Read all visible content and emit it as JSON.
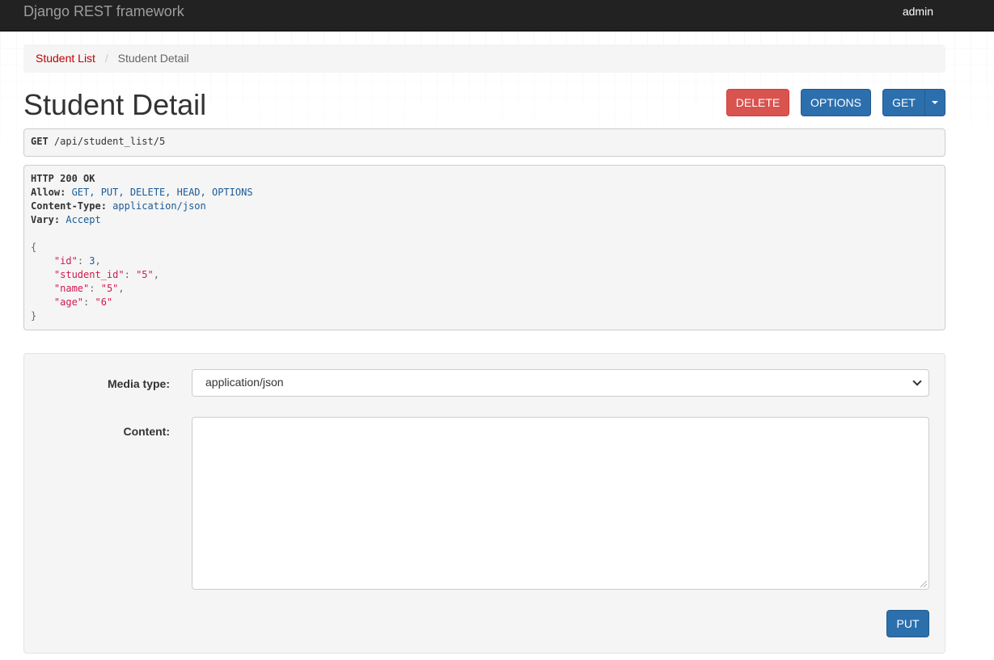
{
  "navbar": {
    "brand": "Django REST framework",
    "user": "admin"
  },
  "breadcrumb": [
    {
      "label": "Student List"
    },
    {
      "label": "Student Detail"
    }
  ],
  "page": {
    "title": "Student Detail"
  },
  "buttons": {
    "delete": "DELETE",
    "options": "OPTIONS",
    "get": "GET",
    "put": "PUT"
  },
  "request": {
    "method": "GET",
    "path": "/api/student_list/5"
  },
  "response": {
    "status": "HTTP 200 OK",
    "headers": [
      {
        "name": "Allow",
        "value": "GET, PUT, DELETE, HEAD, OPTIONS"
      },
      {
        "name": "Content-Type",
        "value": "application/json"
      },
      {
        "name": "Vary",
        "value": "Accept"
      }
    ],
    "body": [
      {
        "key": "\"id\"",
        "value": "3",
        "kind": "num"
      },
      {
        "key": "\"student_id\"",
        "value": "\"5\"",
        "kind": "str"
      },
      {
        "key": "\"name\"",
        "value": "\"5\"",
        "kind": "str"
      },
      {
        "key": "\"age\"",
        "value": "\"6\"",
        "kind": "str"
      }
    ]
  },
  "form": {
    "media_type_label": "Media type:",
    "media_type_value": "application/json",
    "content_label": "Content:",
    "content_value": ""
  },
  "colors": {
    "navbar": "#222222",
    "link": "#c20000",
    "primary": "#2c6fad",
    "danger": "#d9534f"
  },
  "icons": {
    "dropdown": "caret-down-icon",
    "select": "chevron-down-icon"
  }
}
